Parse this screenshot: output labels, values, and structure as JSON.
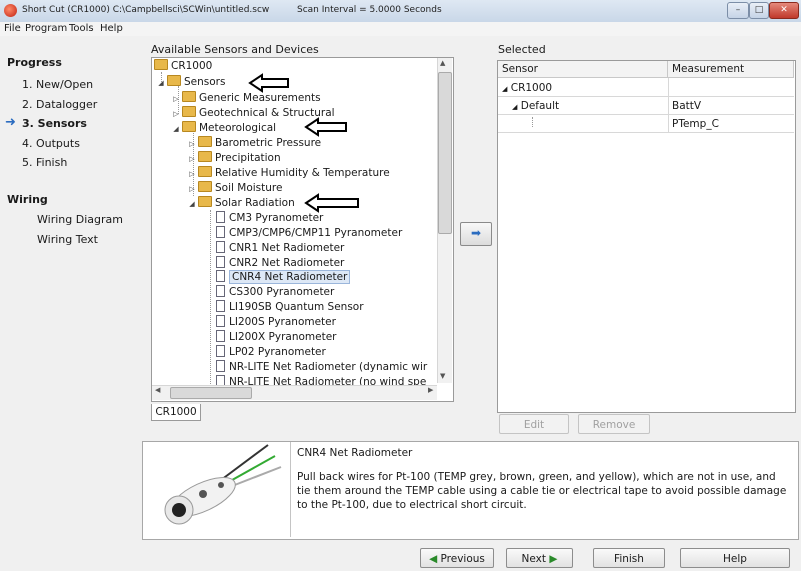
{
  "window": {
    "title": "Short Cut (CR1000) C:\\Campbellsci\\SCWin\\untitled.scw",
    "scan_interval": "Scan Interval = 5.0000 Seconds"
  },
  "menu": [
    "File",
    "Program",
    "Tools",
    "Help"
  ],
  "progress": {
    "heading": "Progress",
    "steps": [
      "1. New/Open",
      "2. Datalogger",
      "3. Sensors",
      "4. Outputs",
      "5. Finish"
    ],
    "current_step": "3. Sensors"
  },
  "wiring": {
    "heading": "Wiring",
    "items": [
      "Wiring Diagram",
      "Wiring Text"
    ]
  },
  "available": {
    "label": "Available Sensors and Devices",
    "root": "CR1000",
    "sensors": "Sensors",
    "groups": [
      "Generic Measurements",
      "Geotechnical & Structural",
      "Meteorological"
    ],
    "met_children": [
      "Barometric Pressure",
      "Precipitation",
      "Relative Humidity & Temperature",
      "Soil Moisture",
      "Solar Radiation"
    ],
    "solar_items": [
      "CM3 Pyranometer",
      "CMP3/CMP6/CMP11 Pyranometer",
      "CNR1 Net Radiometer",
      "CNR2 Net Radiometer",
      "CNR4 Net Radiometer",
      "CS300 Pyranometer",
      "LI190SB Quantum Sensor",
      "LI200S Pyranometer",
      "LI200X Pyranometer",
      "LP02 Pyranometer",
      "NR-LITE Net Radiometer (dynamic wir",
      "NR-LITE Net Radiometer (no wind spe"
    ],
    "selected_item": "CNR4 Net Radiometer",
    "tab": "CR1000"
  },
  "add_button_icon": "right-arrow-icon",
  "selected": {
    "label": "Selected",
    "columns": [
      "Sensor",
      "Measurement"
    ],
    "rows": [
      {
        "sensor": "CR1000",
        "measurement": ""
      },
      {
        "sensor": "Default",
        "measurement": "BattV"
      },
      {
        "sensor": "",
        "measurement": "PTemp_C"
      }
    ],
    "edit": "Edit",
    "remove": "Remove"
  },
  "description": {
    "name": "CNR4 Net Radiometer",
    "text": "Pull back wires for Pt-100 (TEMP grey, brown, green, and yellow), which are not in use, and tie them around the TEMP cable using a cable tie or electrical tape to avoid possible damage to the Pt-100, due to electrical short circuit."
  },
  "footer": {
    "previous": "Previous",
    "next": "Next",
    "finish": "Finish",
    "help": "Help"
  },
  "colors": {
    "accent": "#2b6cc0",
    "folder": "#e8b84a"
  }
}
